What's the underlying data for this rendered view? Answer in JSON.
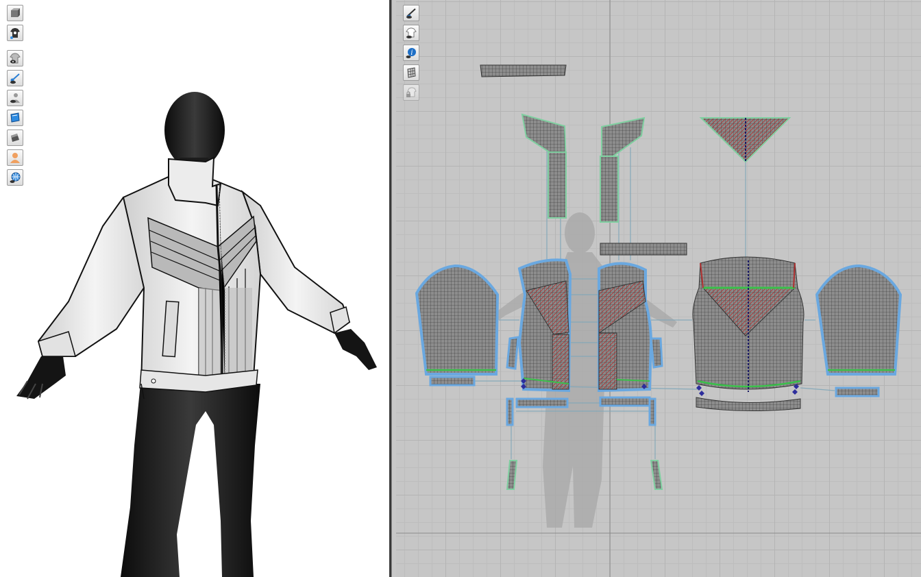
{
  "app": {
    "name": "",
    "accent_blue": "#4a90d9",
    "panel_bg": "#c6c6c6"
  },
  "view3d": {
    "toolbar": [
      {
        "name": "avatar-display-icon"
      },
      {
        "name": "garment-display-icon"
      },
      {
        "name": "show-garment-icon"
      },
      {
        "name": "show-pins-icon"
      },
      {
        "name": "show-avatar-icon"
      },
      {
        "name": "texture-mode-icon"
      },
      {
        "name": "solid-mode-icon"
      },
      {
        "name": "avatar-skin-icon"
      },
      {
        "name": "environment-icon"
      }
    ]
  },
  "view2d": {
    "toolbar": [
      {
        "name": "show-sewing-lines-icon"
      },
      {
        "name": "show-pattern-icon"
      },
      {
        "name": "show-info-icon"
      },
      {
        "name": "show-mesh-icon"
      },
      {
        "name": "lock-pattern-icon"
      }
    ]
  }
}
